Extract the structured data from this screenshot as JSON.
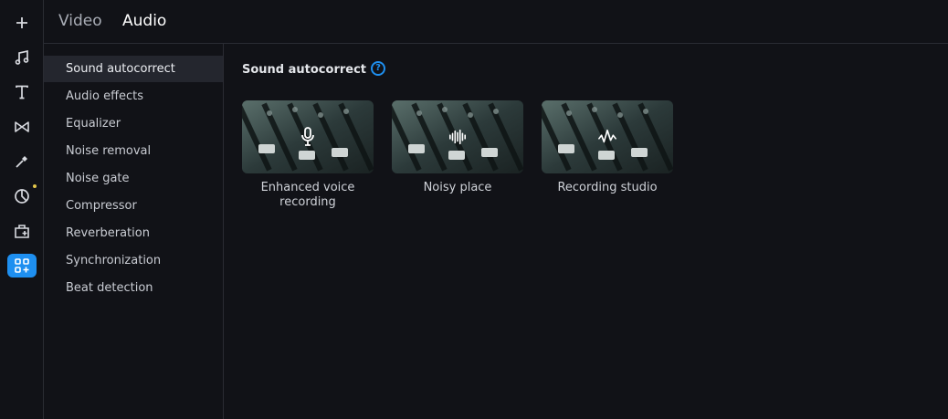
{
  "tabs": {
    "video": "Video",
    "audio": "Audio"
  },
  "rail": [
    {
      "name": "add-icon"
    },
    {
      "name": "music-icon"
    },
    {
      "name": "text-icon"
    },
    {
      "name": "transitions-icon"
    },
    {
      "name": "magic-wand-icon"
    },
    {
      "name": "stickers-icon"
    },
    {
      "name": "store-icon"
    },
    {
      "name": "more-tools-icon",
      "active": true
    }
  ],
  "sidebar": {
    "items": [
      {
        "label": "Sound autocorrect",
        "active": true
      },
      {
        "label": "Audio effects"
      },
      {
        "label": "Equalizer"
      },
      {
        "label": "Noise removal"
      },
      {
        "label": "Noise gate"
      },
      {
        "label": "Compressor"
      },
      {
        "label": "Reverberation"
      },
      {
        "label": "Synchronization"
      },
      {
        "label": "Beat detection"
      }
    ]
  },
  "panel": {
    "title": "Sound autocorrect",
    "help": "?",
    "presets": [
      {
        "label": "Enhanced voice recording",
        "icon": "microphone-icon"
      },
      {
        "label": "Noisy place",
        "icon": "waveform-icon"
      },
      {
        "label": "Recording studio",
        "icon": "soundwave-icon"
      }
    ]
  },
  "colors": {
    "accent": "#1e8ff0",
    "background": "#111217",
    "notification_dot": "#e3c64a"
  }
}
